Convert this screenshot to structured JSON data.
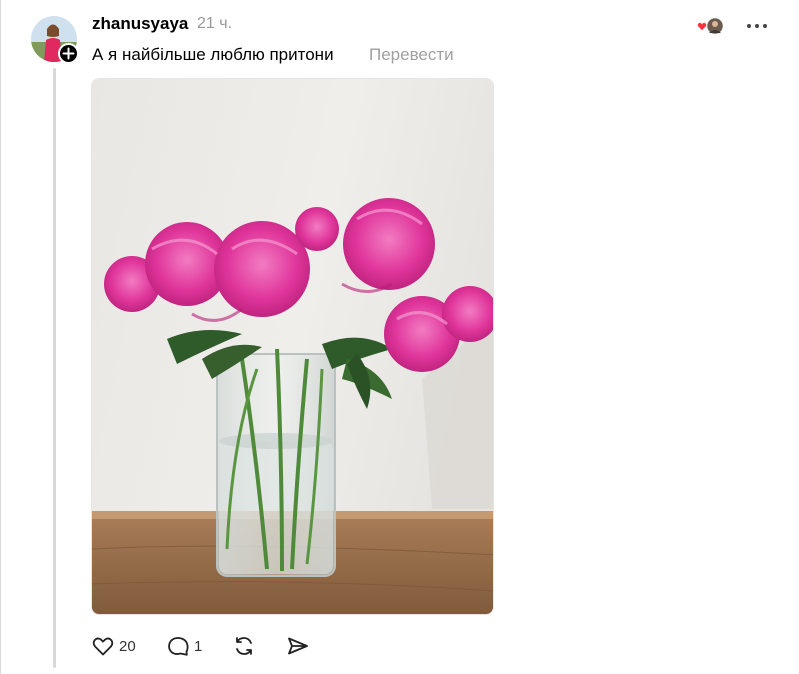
{
  "post": {
    "username": "zhanusyaya",
    "time": "21 ч.",
    "text": "А я найбільше люблю притони",
    "translate_label": "Перевести",
    "media_alt": "Рожеві півонії у скляній вазі на дерев'яній полиці",
    "actions": {
      "like_count": "20",
      "reply_count": "1"
    }
  },
  "icons": {
    "follow": "plus-icon",
    "liked_by": "heart-avatar-icon",
    "more": "ellipsis-icon",
    "like": "heart-icon",
    "reply": "comment-icon",
    "repost": "repost-icon",
    "share": "send-icon"
  },
  "colors": {
    "muted_text": "#999999",
    "heart_red": "#ff3040",
    "peony_pink": "#e0359b"
  }
}
